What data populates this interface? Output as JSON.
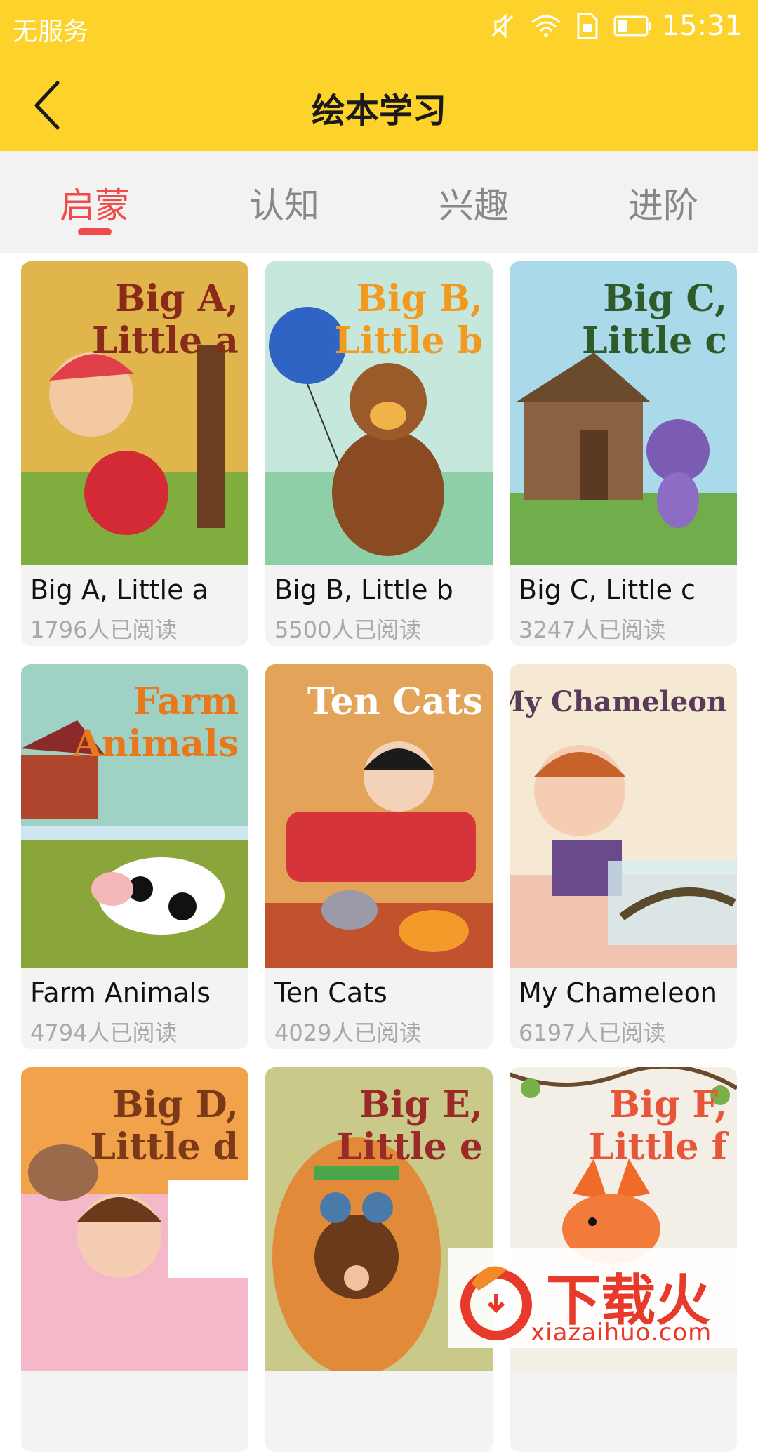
{
  "status_bar": {
    "carrier": "无服务",
    "time": "15:31"
  },
  "header": {
    "title": "绘本学习",
    "back_icon": "chevron-left-icon"
  },
  "tabs": [
    {
      "label": "启蒙",
      "active": true
    },
    {
      "label": "认知",
      "active": false
    },
    {
      "label": "兴趣",
      "active": false
    },
    {
      "label": "进阶",
      "active": false
    }
  ],
  "books": [
    {
      "cover_title": "Big A,\nLittle a",
      "name": "Big A, Little a",
      "reads": "1796人已阅读",
      "cover_color": "#d9b04a",
      "title_color": "#8a2a1a"
    },
    {
      "cover_title": "Big B,\nLittle b",
      "name": "Big B, Little b",
      "reads": "5500人已阅读",
      "cover_color": "#bfe3d8",
      "title_color": "#f29a1f"
    },
    {
      "cover_title": "Big C,\nLittle c",
      "name": "Big C, Little c",
      "reads": "3247人已阅读",
      "cover_color": "#a9d9ea",
      "title_color": "#2f5a2a"
    },
    {
      "cover_title": "Farm\nAnimals",
      "name": "Farm Animals",
      "reads": "4794人已阅读",
      "cover_color": "#9fd1c4",
      "title_color": "#e9781c"
    },
    {
      "cover_title": "Ten Cats",
      "name": "Ten Cats",
      "reads": "4029人已阅读",
      "cover_color": "#e3a45a",
      "title_color": "#ffffff"
    },
    {
      "cover_title": "My Chameleon",
      "name": "My Chameleon",
      "reads": "6197人已阅读",
      "cover_color": "#f5e9d4",
      "title_color": "#5a3a5a"
    },
    {
      "cover_title": "Big D,\nLittle d",
      "name": "",
      "reads": "",
      "cover_color": "#f1a24a",
      "title_color": "#7a3a1a"
    },
    {
      "cover_title": "Big E,\nLittle e",
      "name": "",
      "reads": "",
      "cover_color": "#c9c98a",
      "title_color": "#9a2a2a"
    },
    {
      "cover_title": "Big F,\nLittle f",
      "name": "",
      "reads": "",
      "cover_color": "#f4efe6",
      "title_color": "#e8563a"
    }
  ],
  "watermark": {
    "title": "下载火",
    "url": "xiazaihuo.com"
  },
  "colors": {
    "header_bg": "#fdd22a",
    "tab_active": "#f04a4a",
    "tab_inactive": "#888888"
  }
}
